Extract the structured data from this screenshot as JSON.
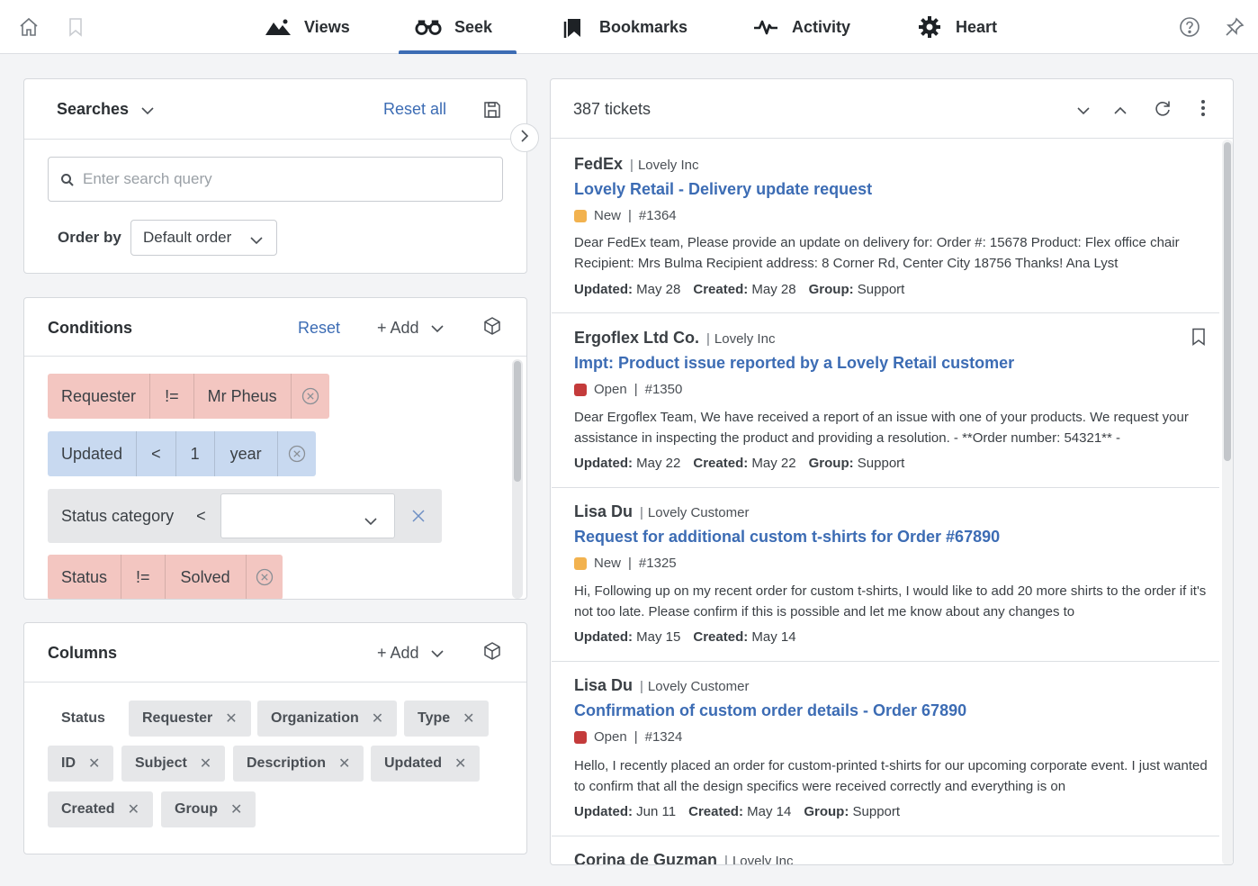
{
  "nav": {
    "tabs": [
      {
        "label": "Views",
        "icon": "mountain-icon"
      },
      {
        "label": "Seek",
        "icon": "binoculars-icon",
        "active": true
      },
      {
        "label": "Bookmarks",
        "icon": "bookmarks-icon"
      },
      {
        "label": "Activity",
        "icon": "activity-icon"
      },
      {
        "label": "Heart",
        "icon": "gear-icon"
      }
    ]
  },
  "searches": {
    "title": "Searches",
    "reset_all": "Reset all",
    "search_placeholder": "Enter search query",
    "order_label": "Order by",
    "order_value": "Default order"
  },
  "conditions": {
    "title": "Conditions",
    "reset": "Reset",
    "add": "+ Add",
    "rows": [
      {
        "field": "Requester",
        "op": "!=",
        "value": "Mr Pheus"
      },
      {
        "field": "Updated",
        "op": "<",
        "num": "1",
        "unit": "year"
      },
      {
        "field": "Status category",
        "op": "<"
      },
      {
        "field": "Status",
        "op": "!=",
        "value": "Solved"
      }
    ]
  },
  "columns": {
    "title": "Columns",
    "add": "+ Add",
    "fixed": "Status",
    "chips": [
      "Requester",
      "Organization",
      "Type",
      "ID",
      "Subject",
      "Description",
      "Updated",
      "Created",
      "Group"
    ]
  },
  "tickets": {
    "count": "387 tickets",
    "items": [
      {
        "sender": "FedEx",
        "org": "Lovely Inc",
        "title": "Lovely Retail - Delivery update request",
        "status": "New",
        "status_color": "#f2b24f",
        "id": "#1364",
        "desc": "Dear FedEx team, Please provide an update on delivery for: Order #: 15678 Product: Flex office chair Recipient: Mrs Bulma Recipient address: 8 Corner Rd, Center City 18756 Thanks! Ana Lyst",
        "updated_label": "Updated:",
        "updated": "May 28",
        "created_label": "Created:",
        "created": "May 28",
        "group_label": "Group:",
        "group": "Support"
      },
      {
        "sender": "Ergoflex Ltd Co.",
        "org": "Lovely Inc",
        "title": "Impt: Product issue reported by a Lovely Retail customer",
        "status": "Open",
        "status_color": "#c43b3b",
        "id": "#1350",
        "desc": "Dear Ergoflex Team, We have received a report of an issue with one of your products. We request your assistance in inspecting the product and providing a resolution. - **Order number: 54321** -",
        "updated_label": "Updated:",
        "updated": "May 22",
        "created_label": "Created:",
        "created": "May 22",
        "group_label": "Group:",
        "group": "Support"
      },
      {
        "sender": "Lisa Du",
        "org": "Lovely Customer",
        "title": "Request for additional custom t-shirts for Order #67890",
        "status": "New",
        "status_color": "#f2b24f",
        "id": "#1325",
        "desc": "Hi, Following up on my recent order for custom t-shirts, I would like to add 20 more shirts to the order if it's not too late. Please confirm if this is possible and let me know about any changes to",
        "updated_label": "Updated:",
        "updated": "May 15",
        "created_label": "Created:",
        "created": "May 14"
      },
      {
        "sender": "Lisa Du",
        "org": "Lovely Customer",
        "title": "Confirmation of custom order details - Order 67890",
        "status": "Open",
        "status_color": "#c43b3b",
        "id": "#1324",
        "desc": "Hello, I recently placed an order for custom-printed t-shirts for our upcoming corporate event. I just wanted to confirm that all the design specifics were received correctly and everything is on",
        "updated_label": "Updated:",
        "updated": "Jun 11",
        "created_label": "Created:",
        "created": "May 14",
        "group_label": "Group:",
        "group": "Support"
      },
      {
        "sender": "Corina de Guzman",
        "org": "Lovely Inc"
      }
    ]
  }
}
